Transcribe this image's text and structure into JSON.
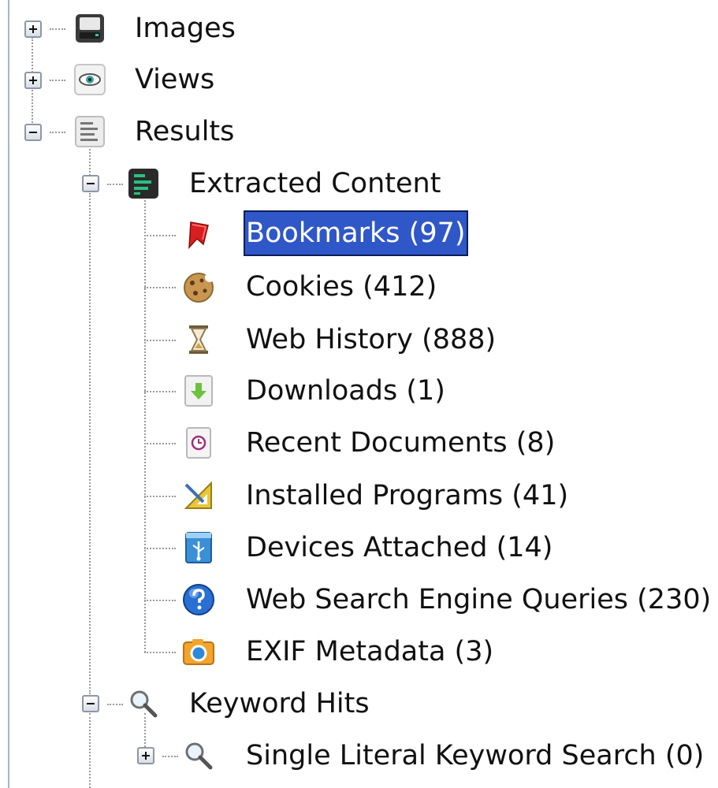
{
  "tree": {
    "images": {
      "label": "Images",
      "icon": "hard-drive-icon"
    },
    "views": {
      "label": "Views",
      "icon": "eye-icon"
    },
    "results": {
      "label": "Results",
      "icon": "document-list-icon"
    },
    "extracted_content": {
      "label": "Extracted Content",
      "icon": "green-list-icon",
      "children": [
        {
          "label": "Bookmarks (97)",
          "icon": "bookmark-icon",
          "selected": true
        },
        {
          "label": "Cookies (412)",
          "icon": "cookie-icon"
        },
        {
          "label": "Web History (888)",
          "icon": "hourglass-icon"
        },
        {
          "label": "Downloads (1)",
          "icon": "download-icon"
        },
        {
          "label": "Recent Documents (8)",
          "icon": "recent-document-icon"
        },
        {
          "label": "Installed Programs (41)",
          "icon": "ruler-triangle-icon"
        },
        {
          "label": "Devices Attached (14)",
          "icon": "usb-icon"
        },
        {
          "label": "Web Search Engine Queries (230)",
          "icon": "search-query-icon"
        },
        {
          "label": "EXIF Metadata (3)",
          "icon": "camera-icon"
        }
      ]
    },
    "keyword_hits": {
      "label": "Keyword Hits",
      "icon": "magnifier-icon",
      "children": [
        {
          "label": "Single Literal Keyword Search (0)",
          "icon": "magnifier-icon"
        }
      ]
    }
  },
  "colors": {
    "selection_bg": "#2f57c8",
    "selection_text": "#ffffff",
    "connector": "#9a9a9a"
  }
}
